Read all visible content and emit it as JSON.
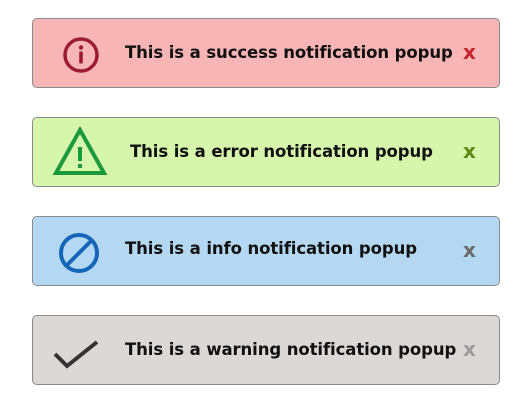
{
  "notifications": [
    {
      "id": "success",
      "message": "This is a success notification popup",
      "close_label": "x",
      "icon": "info-circle-icon",
      "background": "#f8b5b6",
      "icon_color": "#9b1b30",
      "close_color": "#c0262c"
    },
    {
      "id": "error",
      "message": "This is a error notification popup",
      "close_label": "x",
      "icon": "warning-triangle-icon",
      "background": "#d5f6ab",
      "icon_color": "#1a9a3c",
      "close_color": "#5c8a12"
    },
    {
      "id": "info",
      "message": "This is a info notification popup",
      "close_label": "x",
      "icon": "prohibited-circle-icon",
      "background": "#b5d8f2",
      "icon_color": "#1565b8",
      "close_color": "#6a6a6a"
    },
    {
      "id": "warning",
      "message": "This is a warning notification popup",
      "close_label": "x",
      "icon": "checkmark-icon",
      "background": "#ddd8d8",
      "icon_color": "#333333",
      "close_color": "#9a9a9a"
    }
  ]
}
